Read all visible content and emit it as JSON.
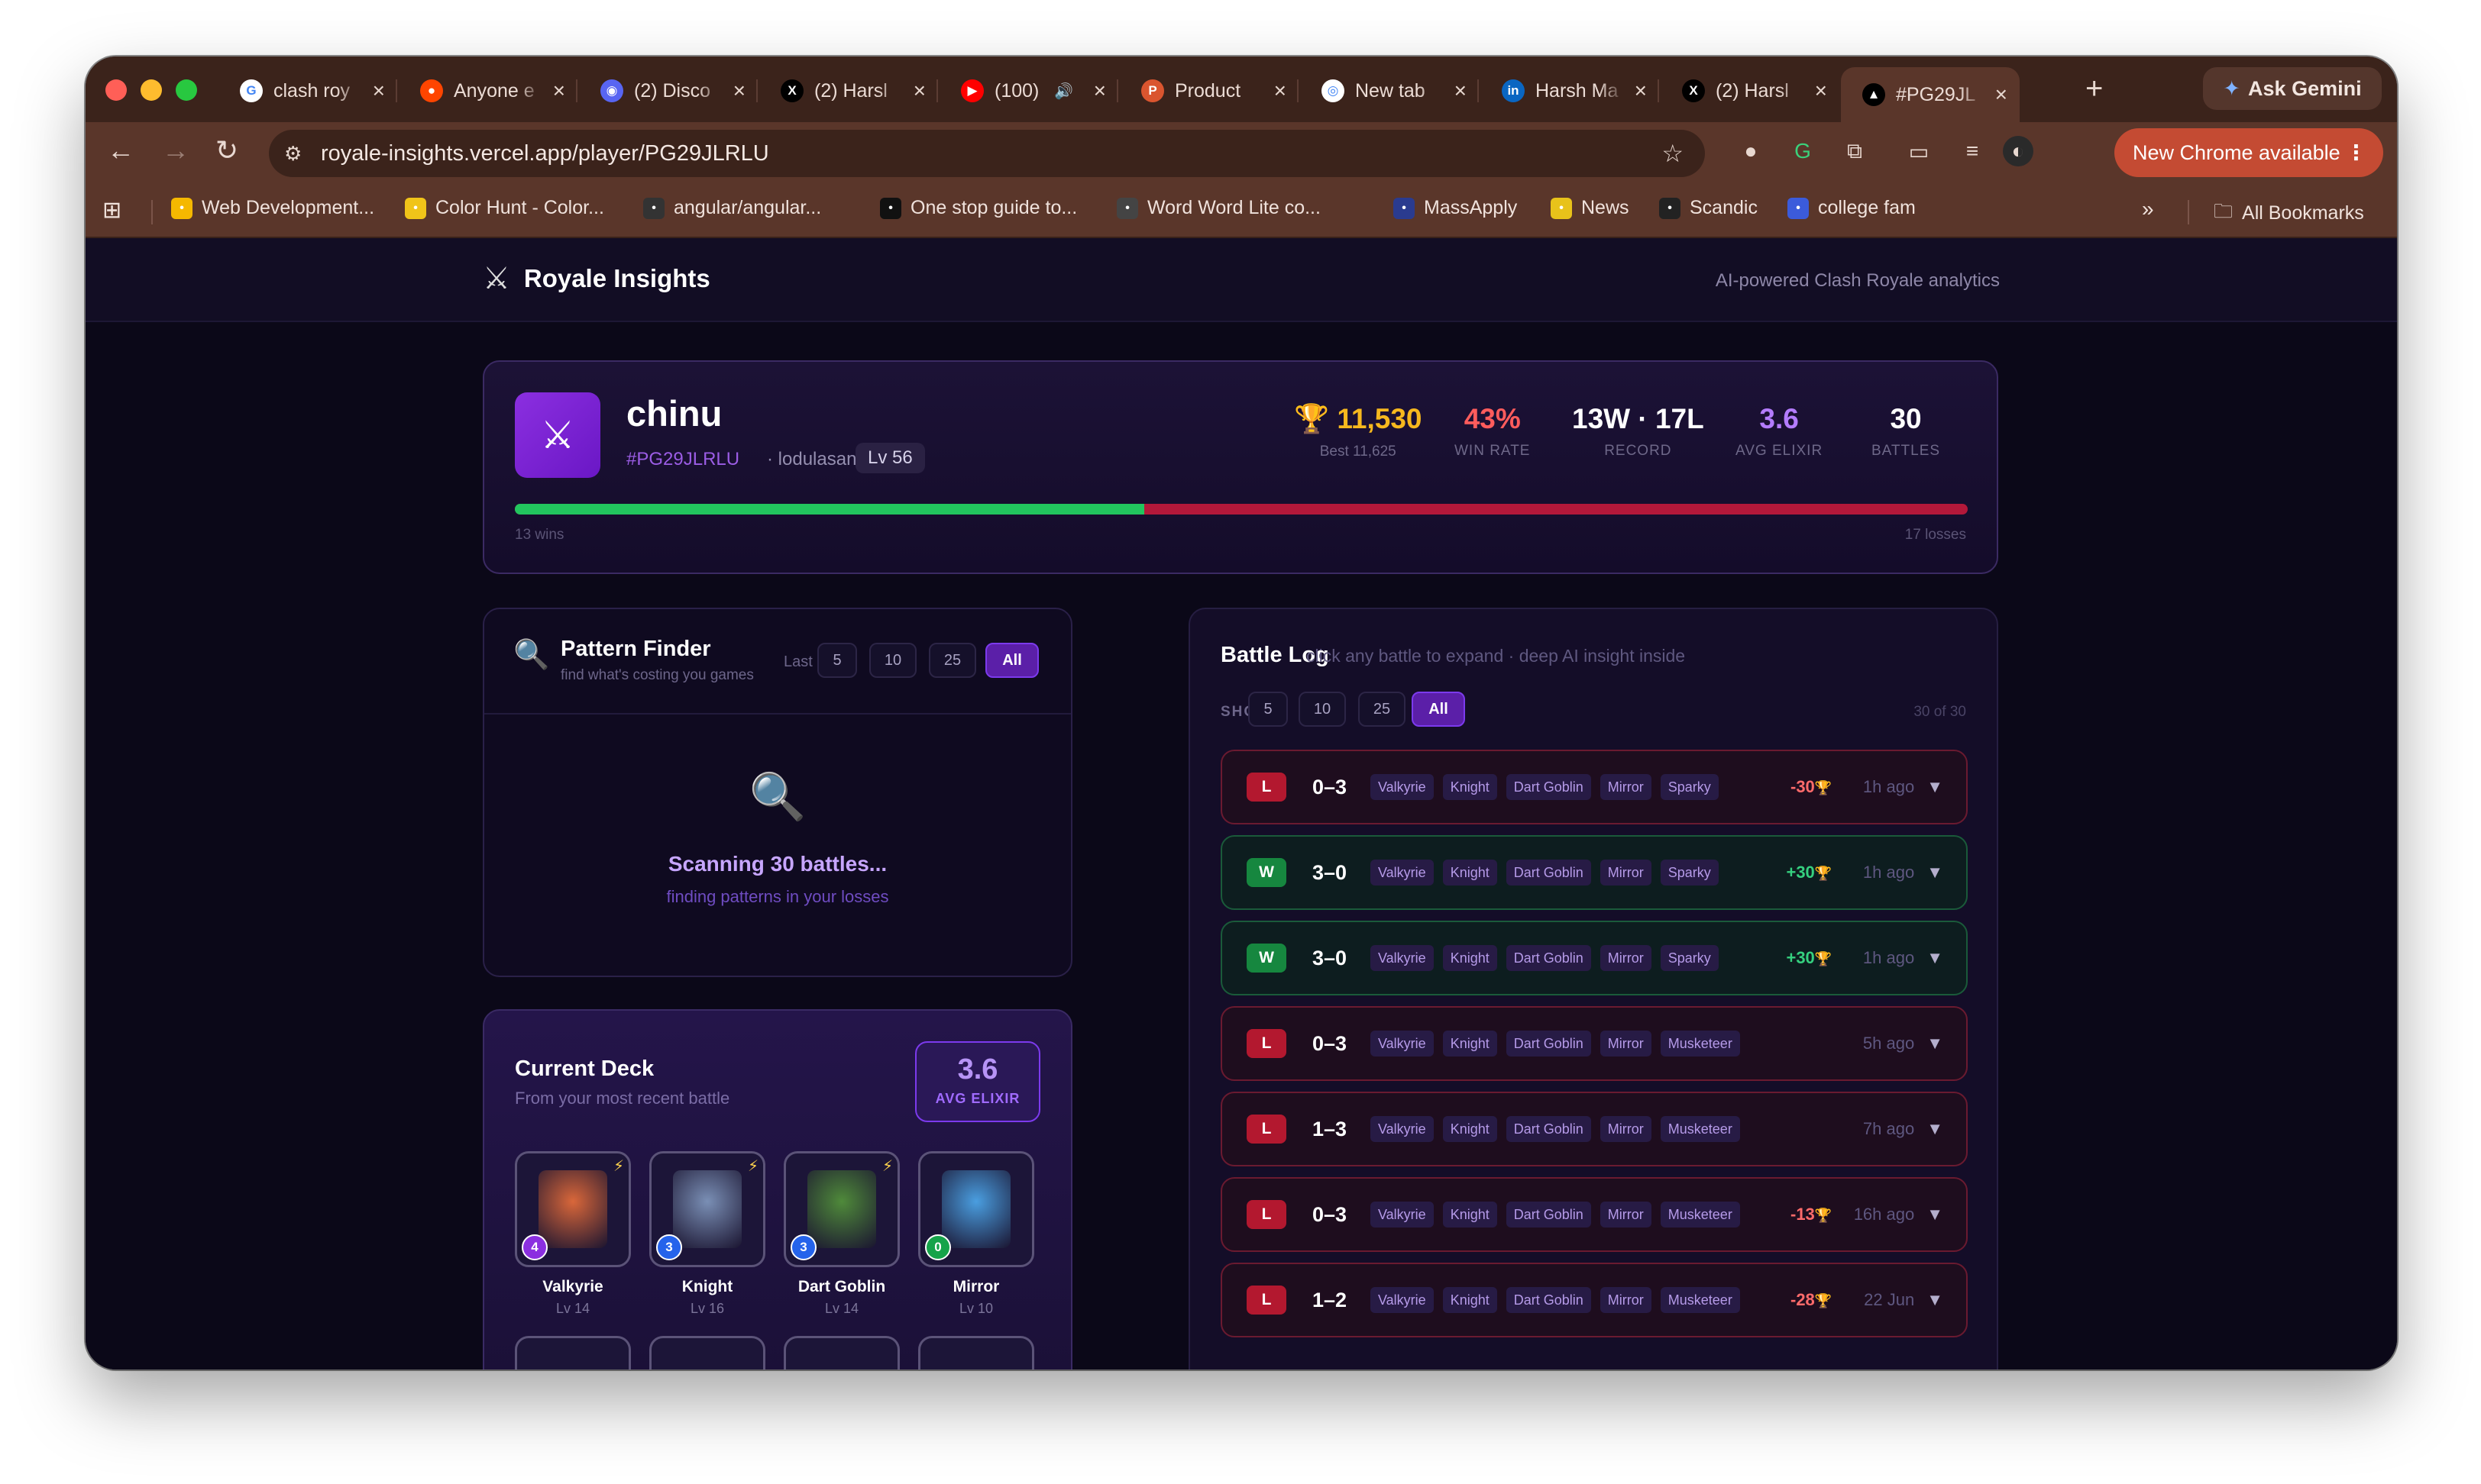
{
  "browser": {
    "tabs": [
      {
        "label": "clash roy",
        "icon": "google-icon",
        "color": "#ffffff"
      },
      {
        "label": "Anyone e",
        "icon": "reddit-icon",
        "color": "#ff4500"
      },
      {
        "label": "(2) Disco",
        "icon": "discord-icon",
        "color": "#5865f2"
      },
      {
        "label": "(2) Harsl",
        "icon": "x-icon",
        "color": "#000000"
      },
      {
        "label": "(100)",
        "icon": "youtube-icon",
        "color": "#ff0000"
      },
      {
        "label": "Product",
        "icon": "producthunt-icon",
        "color": "#da552f"
      },
      {
        "label": "New tab",
        "icon": "chrome-icon",
        "color": "#ffffff"
      },
      {
        "label": "Harsh Ma",
        "icon": "linkedin-icon",
        "color": "#0a66c2"
      },
      {
        "label": "(2) Harsl",
        "icon": "x-icon",
        "color": "#000000"
      },
      {
        "label": "#PG29JL",
        "icon": "vercel-icon",
        "color": "#000000"
      }
    ],
    "gemini_label": "Ask Gemini",
    "url": "royale-insights.vercel.app/player/PG29JLRLU",
    "update_label": "New Chrome available",
    "bookmarks": [
      {
        "label": "Web Development..."
      },
      {
        "label": "Color Hunt - Color..."
      },
      {
        "label": "angular/angular..."
      },
      {
        "label": "One stop guide to..."
      },
      {
        "label": "Word Word Lite co..."
      },
      {
        "label": "MassApply"
      },
      {
        "label": "News"
      },
      {
        "label": "Scandic"
      },
      {
        "label": "college fam"
      }
    ],
    "all_bookmarks_label": "All Bookmarks"
  },
  "app": {
    "brand": "Royale Insights",
    "tagline": "AI-powered Clash Royale analytics"
  },
  "profile": {
    "name": "chinu",
    "tag": "#PG29JLRLU",
    "clan": "· lodulasan",
    "level": "Lv 56",
    "trophies": "11,530",
    "best": "Best 11,625",
    "win_rate": "43%",
    "win_rate_label": "WIN RATE",
    "record": "13W · 17L",
    "record_label": "RECORD",
    "avg_elixir": "3.6",
    "avg_elixir_label": "AVG ELIXIR",
    "battles": "30",
    "battles_label": "BATTLES",
    "wins_label": "13 wins",
    "losses_label": "17 losses",
    "win_fraction": 0.4333
  },
  "pattern_finder": {
    "title": "Pattern Finder",
    "subtitle": "find what's costing you games",
    "last_label": "Last",
    "options": [
      "5",
      "10",
      "25",
      "All"
    ],
    "selected": "All",
    "scan_title": "Scanning 30 battles...",
    "scan_sub": "finding patterns in your losses"
  },
  "deck": {
    "title": "Current Deck",
    "subtitle": "From your most recent battle",
    "avg_value": "3.6",
    "avg_label": "AVG ELIXIR",
    "cards": [
      {
        "name": "Valkyrie",
        "level": "Lv 14",
        "cost": "4",
        "cost_color": "#8b2fe0",
        "art": "#d9673a"
      },
      {
        "name": "Knight",
        "level": "Lv 16",
        "cost": "3",
        "cost_color": "#2563eb",
        "art": "#7a8fb5"
      },
      {
        "name": "Dart Goblin",
        "level": "Lv 14",
        "cost": "3",
        "cost_color": "#2563eb",
        "art": "#4f8a3a"
      },
      {
        "name": "Mirror",
        "level": "Lv 10",
        "cost": "0",
        "cost_color": "#16a34a",
        "art": "#4a9ee0"
      }
    ]
  },
  "battle_log": {
    "title": "Battle Log",
    "subtitle": "click any battle to expand · deep AI insight inside",
    "show_label": "SHOW",
    "options": [
      "5",
      "10",
      "25",
      "All"
    ],
    "selected": "All",
    "count_label": "30 of 30",
    "battles": [
      {
        "result": "L",
        "score": "0–3",
        "cards": [
          "Valkyrie",
          "Knight",
          "Dart Goblin",
          "Mirror",
          "Sparky"
        ],
        "trophies": "-30",
        "time": "1h ago"
      },
      {
        "result": "W",
        "score": "3–0",
        "cards": [
          "Valkyrie",
          "Knight",
          "Dart Goblin",
          "Mirror",
          "Sparky"
        ],
        "trophies": "+30",
        "time": "1h ago"
      },
      {
        "result": "W",
        "score": "3–0",
        "cards": [
          "Valkyrie",
          "Knight",
          "Dart Goblin",
          "Mirror",
          "Sparky"
        ],
        "trophies": "+30",
        "time": "1h ago"
      },
      {
        "result": "L",
        "score": "0–3",
        "cards": [
          "Valkyrie",
          "Knight",
          "Dart Goblin",
          "Mirror",
          "Musketeer"
        ],
        "trophies": "",
        "time": "5h ago"
      },
      {
        "result": "L",
        "score": "1–3",
        "cards": [
          "Valkyrie",
          "Knight",
          "Dart Goblin",
          "Mirror",
          "Musketeer"
        ],
        "trophies": "",
        "time": "7h ago"
      },
      {
        "result": "L",
        "score": "0–3",
        "cards": [
          "Valkyrie",
          "Knight",
          "Dart Goblin",
          "Mirror",
          "Musketeer"
        ],
        "trophies": "-13",
        "time": "16h ago"
      },
      {
        "result": "L",
        "score": "1–2",
        "cards": [
          "Valkyrie",
          "Knight",
          "Dart Goblin",
          "Mirror",
          "Musketeer"
        ],
        "trophies": "-28",
        "time": "22 Jun"
      }
    ]
  }
}
